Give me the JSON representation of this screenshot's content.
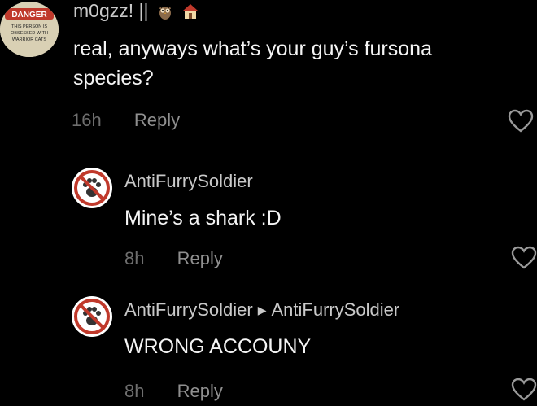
{
  "comments": [
    {
      "username": "m0gzz! ||",
      "text_lines": [
        "real, anyways what’s your guy’s fursona",
        "species?"
      ],
      "time": "16h",
      "reply_label": "Reply",
      "avatar_text": {
        "badge": "DANGER",
        "lines": [
          "THIS PERSON IS",
          "OBSESSED WITH",
          "WARRIOR CATS"
        ]
      },
      "emojis": [
        "owl-emoji",
        "house-emoji"
      ]
    },
    {
      "username": "AntiFurrySoldier",
      "text": "Mine’s a shark :D",
      "time": "8h",
      "reply_label": "Reply"
    },
    {
      "username": "AntiFurrySoldier",
      "reply_to": "AntiFurrySoldier",
      "text": "WRONG ACCOUNY",
      "time": "8h",
      "reply_label": "Reply"
    }
  ],
  "colors": {
    "background": "#000000",
    "text": "#f4f4f4",
    "username": "#c9c9c9",
    "muted": "#8f8f8f",
    "danger_red": "#c0392b"
  }
}
